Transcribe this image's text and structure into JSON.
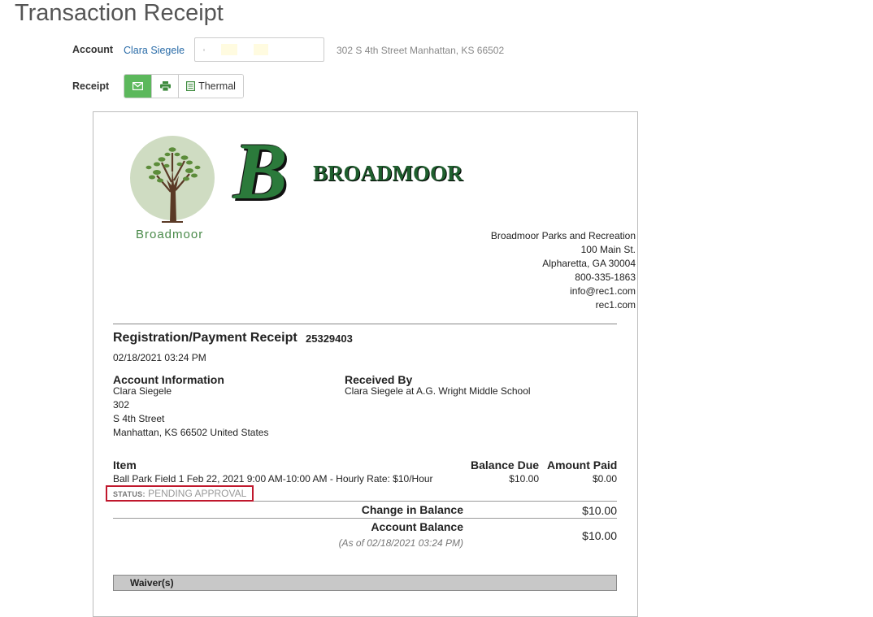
{
  "page": {
    "title": "Transaction Receipt"
  },
  "account": {
    "label": "Account",
    "name": "Clara Siegele",
    "address": "302 S 4th Street Manhattan, KS 66502"
  },
  "receipt_controls": {
    "label": "Receipt",
    "email_icon": "envelope-icon",
    "print_icon": "printer-icon",
    "thermal_icon": "document-icon",
    "thermal_label": "Thermal",
    "accent": "#5cb85c"
  },
  "receipt": {
    "logo_text": "Broadmoor",
    "brand_letter": "B",
    "brand_name": "BROADMOOR",
    "org": [
      "Broadmoor Parks and Recreation",
      "100 Main St.",
      "Alpharetta, GA 30004",
      "800-335-1863",
      "info@rec1.com",
      "rec1.com"
    ],
    "title": "Registration/Payment Receipt",
    "number": "25329403",
    "date": "02/18/2021 03:24 PM",
    "account_info": {
      "heading": "Account Information",
      "lines": [
        "Clara Siegele",
        "302",
        "S 4th Street",
        "Manhattan, KS 66502 United States"
      ]
    },
    "received_by": {
      "heading": "Received By",
      "value": "Clara Siegele at A.G. Wright Middle School"
    },
    "items": {
      "col_item": "Item",
      "col_balance": "Balance Due",
      "col_paid": "Amount Paid",
      "rows": [
        {
          "desc": "Ball Park Field 1 Feb 22, 2021 9:00 AM-10:00 AM - Hourly Rate: $10/Hour",
          "balance": "$10.00",
          "paid": "$0.00",
          "status_label": "STATUS:",
          "status": "PENDING APPROVAL"
        }
      ]
    },
    "change_label": "Change in Balance",
    "change_value": "$10.00",
    "account_balance_label": "Account Balance",
    "account_balance_note": "(As of 02/18/2021 03:24 PM)",
    "account_balance_value": "$10.00",
    "waiver_heading": "Waiver(s)",
    "highlight_color": "#c0182d"
  }
}
